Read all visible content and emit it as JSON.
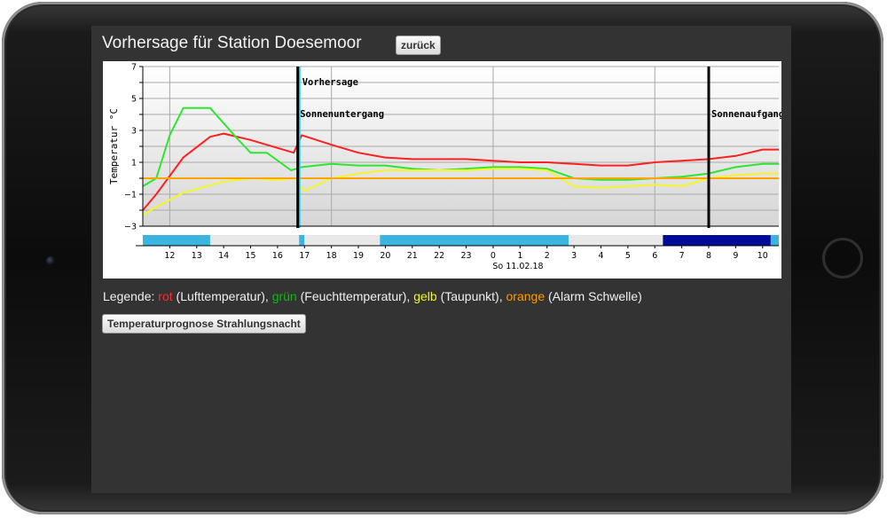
{
  "page": {
    "title": "Vorhersage für Station Doesemoor",
    "back_label": "zurück",
    "button_label": "Temperaturprognose Strahlungsnacht"
  },
  "legend": {
    "prefix": "Legende: ",
    "items": [
      {
        "word": "rot",
        "desc": " (Lufttemperatur), ",
        "color": "#ff2a2a"
      },
      {
        "word": "grün",
        "desc": " (Feuchttemperatur), ",
        "color": "#12b812"
      },
      {
        "word": "gelb",
        "desc": " (Taupunkt), ",
        "color": "#f3f32a"
      },
      {
        "word": "orange",
        "desc": " (Alarm Schwelle)",
        "color": "#ff9a00"
      }
    ]
  },
  "chart_data": {
    "type": "line",
    "ylabel": "Temperatur °C",
    "ylim": [
      -3,
      7
    ],
    "y_ticks": [
      -3,
      -1,
      1,
      3,
      5,
      7
    ],
    "x_start_hour": 11,
    "x_end_hour": 34.6,
    "x_ticks": [
      {
        "h": 12,
        "label": "12"
      },
      {
        "h": 13,
        "label": "13"
      },
      {
        "h": 14,
        "label": "14"
      },
      {
        "h": 15,
        "label": "15"
      },
      {
        "h": 16,
        "label": "16"
      },
      {
        "h": 17,
        "label": "17"
      },
      {
        "h": 18,
        "label": "18"
      },
      {
        "h": 19,
        "label": "19"
      },
      {
        "h": 20,
        "label": "20"
      },
      {
        "h": 21,
        "label": "21"
      },
      {
        "h": 22,
        "label": "22"
      },
      {
        "h": 23,
        "label": "23"
      },
      {
        "h": 24,
        "label": "0"
      },
      {
        "h": 25,
        "label": "1"
      },
      {
        "h": 26,
        "label": "2"
      },
      {
        "h": 27,
        "label": "3"
      },
      {
        "h": 28,
        "label": "4"
      },
      {
        "h": 29,
        "label": "5"
      },
      {
        "h": 30,
        "label": "6"
      },
      {
        "h": 31,
        "label": "7"
      },
      {
        "h": 32,
        "label": "8"
      },
      {
        "h": 33,
        "label": "9"
      },
      {
        "h": 34,
        "label": "10"
      }
    ],
    "date_label": "So 11.02.18",
    "major_grid_hours": [
      12,
      18,
      24,
      30
    ],
    "markers": [
      {
        "h": 16.75,
        "label": "Vorhersage",
        "color": "#000000"
      },
      {
        "h": 16.8,
        "label": "Sonnenuntergang",
        "color": "#22d3ee"
      },
      {
        "h": 32.0,
        "label": "Sonnenaufgang",
        "color": "#000000"
      }
    ],
    "series": [
      {
        "name": "Lufttemperatur",
        "color": "#ff2020",
        "points": [
          [
            11,
            -2
          ],
          [
            11.5,
            -1
          ],
          [
            12.5,
            1.3
          ],
          [
            13.5,
            2.6
          ],
          [
            14,
            2.8
          ],
          [
            15,
            2.4
          ],
          [
            16,
            1.9
          ],
          [
            16.6,
            1.6
          ],
          [
            16.9,
            2.7
          ],
          [
            18,
            2.1
          ],
          [
            19,
            1.6
          ],
          [
            20,
            1.3
          ],
          [
            21,
            1.2
          ],
          [
            22,
            1.2
          ],
          [
            23,
            1.2
          ],
          [
            24,
            1.1
          ],
          [
            25,
            1.0
          ],
          [
            26,
            1.0
          ],
          [
            27,
            0.9
          ],
          [
            28,
            0.8
          ],
          [
            29,
            0.8
          ],
          [
            30,
            1.0
          ],
          [
            31,
            1.1
          ],
          [
            32,
            1.2
          ],
          [
            33,
            1.4
          ],
          [
            34,
            1.8
          ],
          [
            34.6,
            1.8
          ]
        ]
      },
      {
        "name": "Feuchttemperatur",
        "color": "#2ee62e",
        "points": [
          [
            11,
            -0.5
          ],
          [
            11.5,
            0
          ],
          [
            12,
            2.7
          ],
          [
            12.5,
            4.4
          ],
          [
            13.5,
            4.4
          ],
          [
            14.5,
            2.5
          ],
          [
            15,
            1.6
          ],
          [
            15.6,
            1.6
          ],
          [
            16.5,
            0.5
          ],
          [
            16.9,
            0.7
          ],
          [
            18,
            0.9
          ],
          [
            19,
            0.8
          ],
          [
            20,
            0.8
          ],
          [
            21,
            0.6
          ],
          [
            22,
            0.5
          ],
          [
            23,
            0.6
          ],
          [
            24,
            0.7
          ],
          [
            25,
            0.7
          ],
          [
            26,
            0.6
          ],
          [
            27,
            0
          ],
          [
            28,
            -0.1
          ],
          [
            29,
            -0.1
          ],
          [
            30,
            0
          ],
          [
            31,
            0.1
          ],
          [
            32,
            0.3
          ],
          [
            33,
            0.7
          ],
          [
            34,
            0.9
          ],
          [
            34.6,
            0.9
          ]
        ]
      },
      {
        "name": "Taupunkt",
        "color": "#f5f52a",
        "points": [
          [
            11,
            -2.3
          ],
          [
            11.5,
            -1.8
          ],
          [
            12.5,
            -0.9
          ],
          [
            14,
            -0.2
          ],
          [
            15,
            0
          ],
          [
            16,
            -0.1
          ],
          [
            16.6,
            0
          ],
          [
            17,
            -0.8
          ],
          [
            18,
            0
          ],
          [
            19,
            0.3
          ],
          [
            20,
            0.5
          ],
          [
            21,
            0.5
          ],
          [
            22,
            0.5
          ],
          [
            23,
            0.5
          ],
          [
            24,
            0.6
          ],
          [
            25,
            0.6
          ],
          [
            26,
            0.5
          ],
          [
            27,
            -0.5
          ],
          [
            28,
            -0.6
          ],
          [
            29,
            -0.5
          ],
          [
            30,
            -0.4
          ],
          [
            31,
            -0.5
          ],
          [
            32,
            0
          ],
          [
            33,
            0.2
          ],
          [
            34,
            0.3
          ],
          [
            34.6,
            0.3
          ]
        ]
      },
      {
        "name": "Alarm Schwelle",
        "color": "#ffa500",
        "points": [
          [
            11,
            0
          ],
          [
            34.6,
            0
          ]
        ]
      }
    ],
    "sky_bar": [
      {
        "from": 11,
        "to": 13.5,
        "color": "#3ab5e0"
      },
      {
        "from": 13.5,
        "to": 16.8,
        "color": "#e8e8e8"
      },
      {
        "from": 16.8,
        "to": 17.0,
        "color": "#3ab5e0"
      },
      {
        "from": 17.0,
        "to": 19.8,
        "color": "#e8e8e8"
      },
      {
        "from": 19.8,
        "to": 26.8,
        "color": "#3ab5e0"
      },
      {
        "from": 26.8,
        "to": 30.3,
        "color": "#e8e8e8"
      },
      {
        "from": 30.3,
        "to": 34.3,
        "color": "#000a99"
      },
      {
        "from": 34.3,
        "to": 34.6,
        "color": "#3ab5e0"
      }
    ]
  }
}
